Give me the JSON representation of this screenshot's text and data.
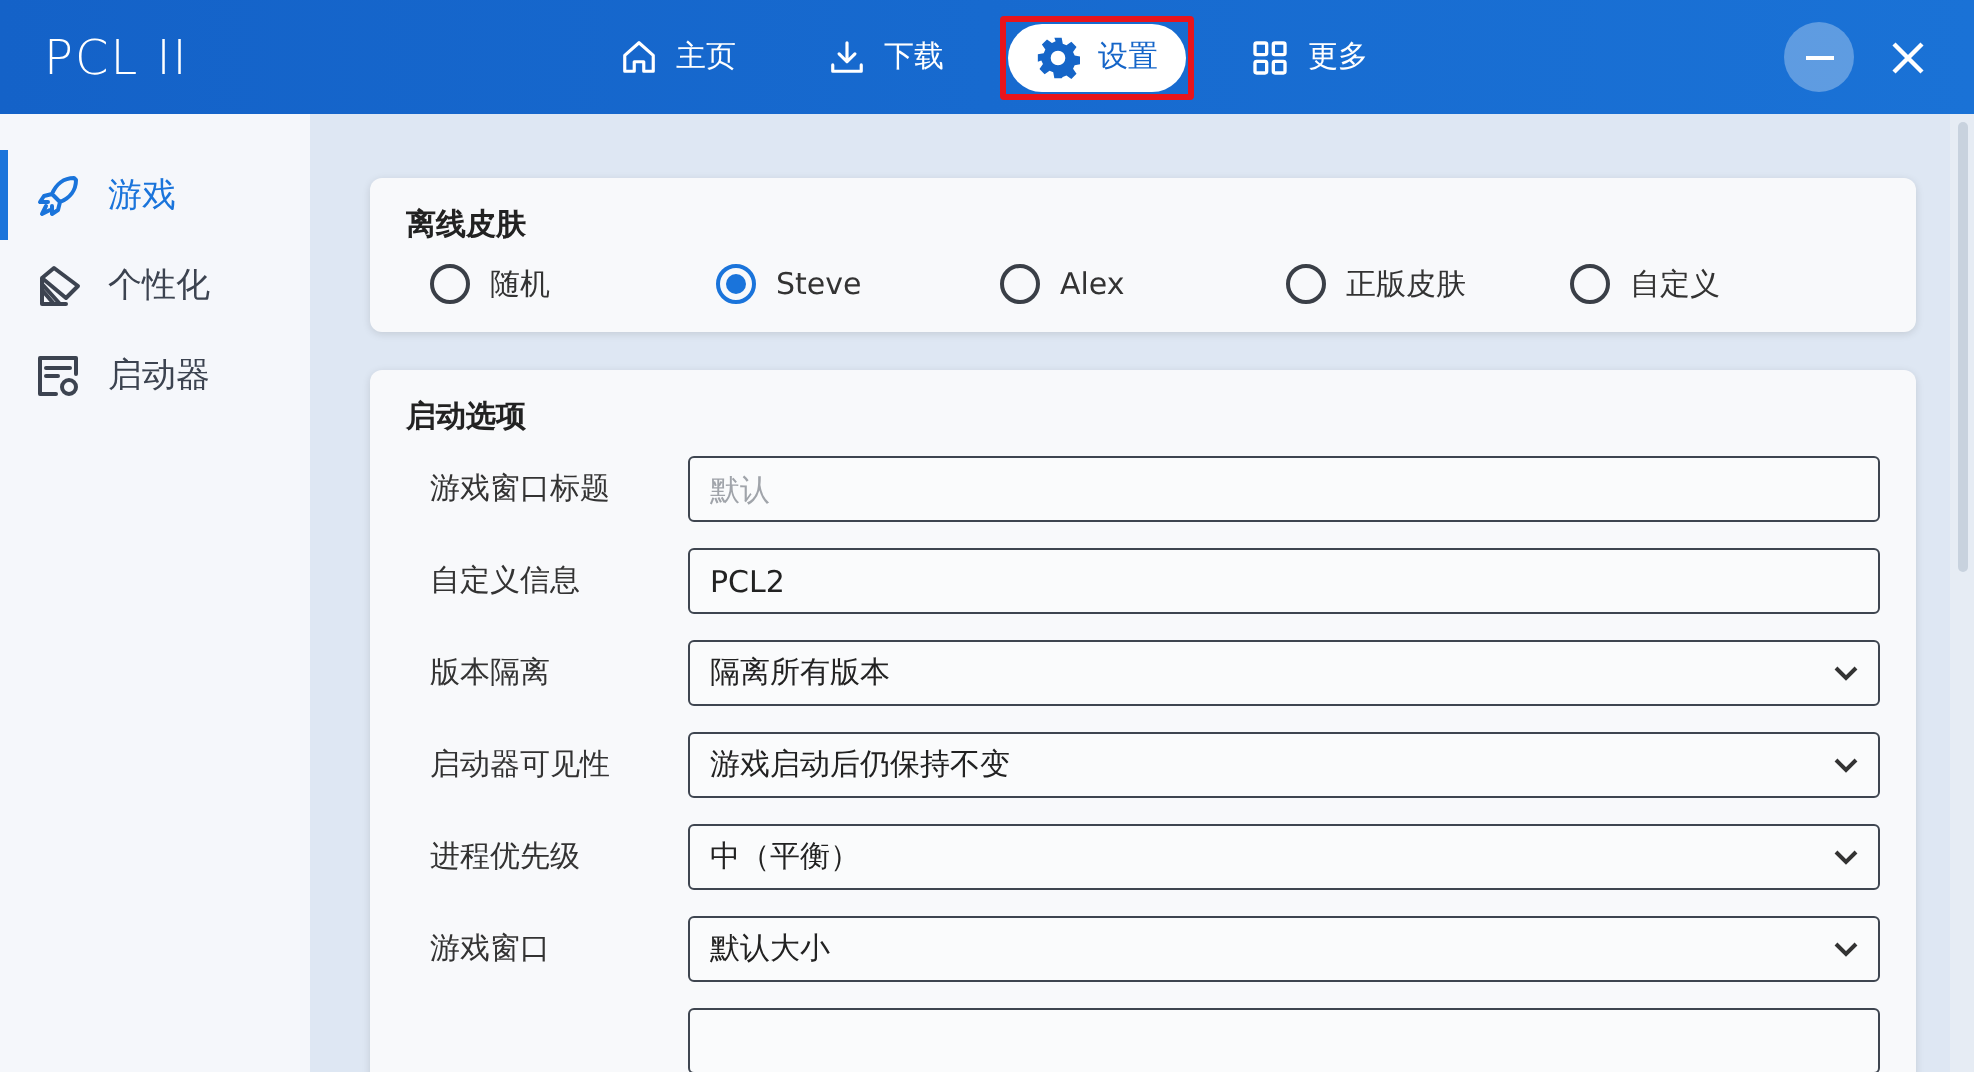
{
  "app": {
    "title": "PCL II"
  },
  "nav": [
    {
      "label": "主页",
      "kind": "home",
      "selected": false,
      "highlighted": false
    },
    {
      "label": "下载",
      "kind": "download",
      "selected": false,
      "highlighted": false
    },
    {
      "label": "设置",
      "kind": "gear",
      "selected": true,
      "highlighted": true
    },
    {
      "label": "更多",
      "kind": "grid",
      "selected": false,
      "highlighted": false
    }
  ],
  "sidebar": {
    "items": [
      {
        "label": "游戏",
        "kind": "rocket",
        "selected": true
      },
      {
        "label": "个性化",
        "kind": "palette",
        "selected": false
      },
      {
        "label": "启动器",
        "kind": "window-gear",
        "selected": false
      }
    ]
  },
  "skin_card": {
    "title": "离线皮肤",
    "options": [
      {
        "label": "随机",
        "selected": false
      },
      {
        "label": "Steve",
        "selected": true
      },
      {
        "label": "Alex",
        "selected": false
      },
      {
        "label": "正版皮肤",
        "selected": false
      },
      {
        "label": "自定义",
        "selected": false
      }
    ]
  },
  "launch_card": {
    "title": "启动选项",
    "rows": [
      {
        "label": "游戏窗口标题",
        "kind": "text",
        "placeholder": "默认"
      },
      {
        "label": "自定义信息",
        "kind": "text",
        "value": "PCL2"
      },
      {
        "label": "版本隔离",
        "kind": "select",
        "value": "隔离所有版本"
      },
      {
        "label": "启动器可见性",
        "kind": "select",
        "value": "游戏启动后仍保持不变"
      },
      {
        "label": "进程优先级",
        "kind": "select",
        "value": "中（平衡）"
      },
      {
        "label": "游戏窗口",
        "kind": "select",
        "value": "默认大小"
      },
      {
        "kind": "text"
      }
    ]
  }
}
